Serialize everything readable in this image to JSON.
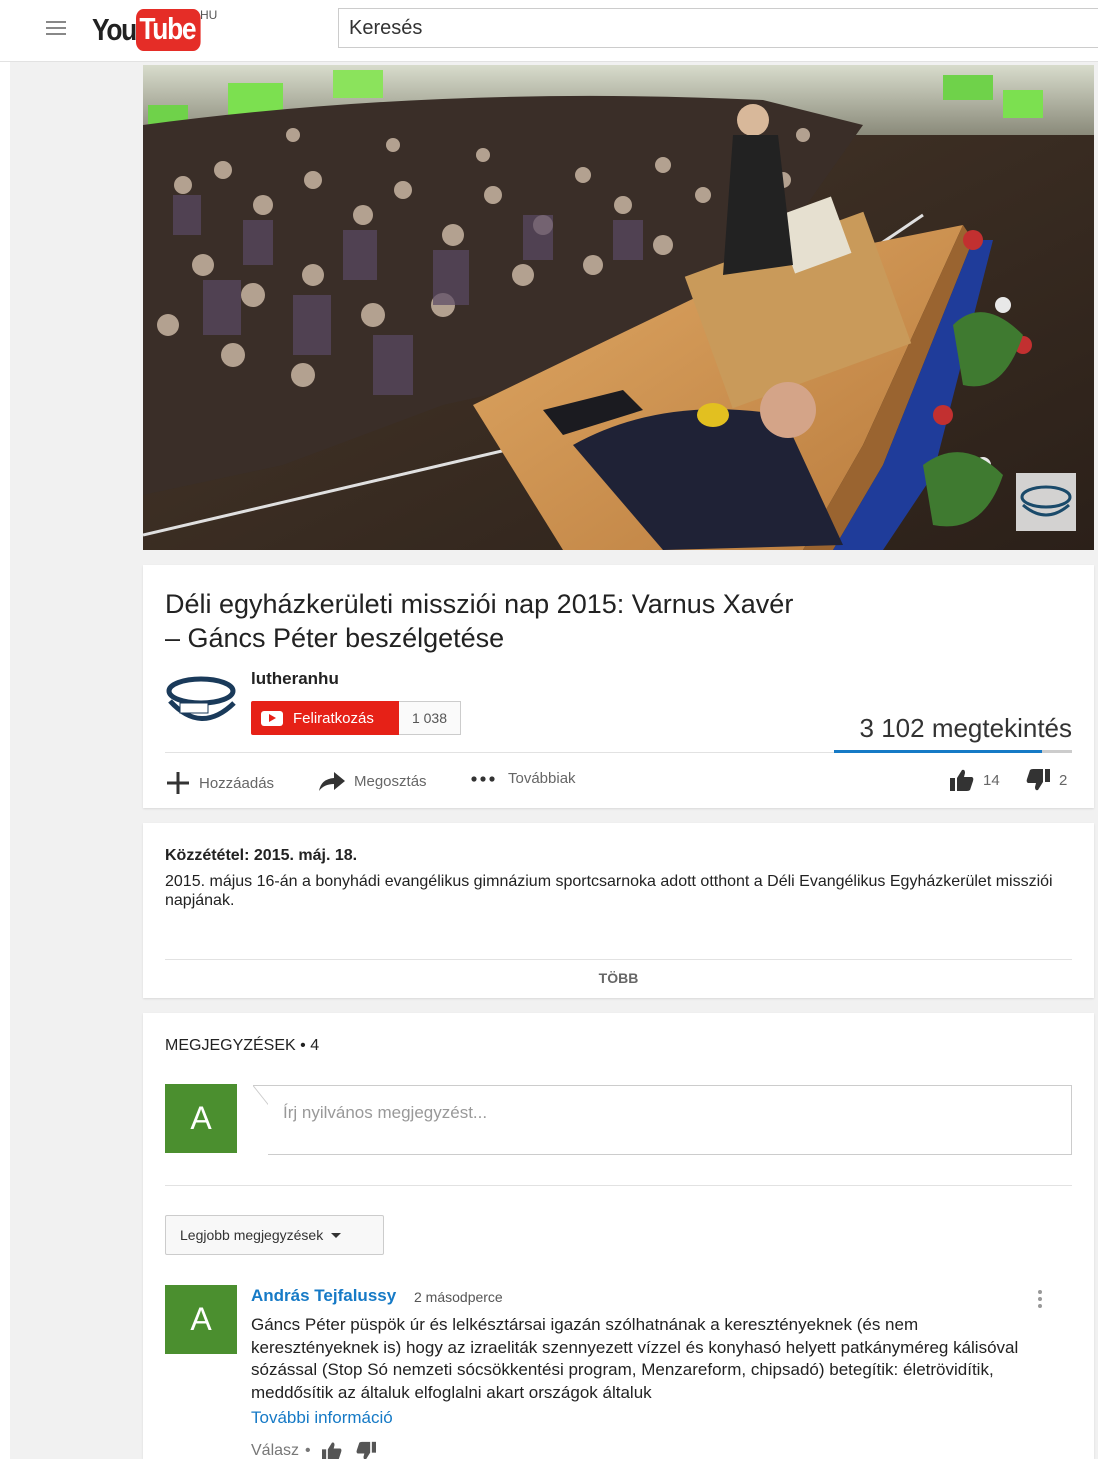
{
  "masthead": {
    "logo_you": "You",
    "logo_tube": "Tube",
    "country_code": "HU",
    "search_placeholder": "Keresés"
  },
  "video": {
    "title": "Déli egyházkerületi missziói nap 2015: Varnus Xavér – Gáncs Péter beszélgetése",
    "channel": {
      "name": "lutheranhu",
      "subscribe_label": "Feliratkozás",
      "subscriber_count": "1 038"
    },
    "views": "3 102 megtekintés",
    "like_ratio": 0.875,
    "actions": {
      "add_label": "Hozzáadás",
      "share_label": "Megosztás",
      "more_label": "Továbbiak"
    },
    "likes": "14",
    "dislikes": "2"
  },
  "description": {
    "published": "Közzététel: 2015. máj. 18.",
    "text": "2015. május 16-án a bonyhádi evangélikus gimnázium sportcsarnoka adott otthont a Déli Evangélikus Egyházkerület missziói napjának.",
    "more_label": "TÖBB"
  },
  "comments": {
    "header": "MEGJEGYZÉSEK • 4",
    "my_avatar_letter": "A",
    "input_placeholder": "Írj nyilvános megjegyzést...",
    "sort_label": "Legjobb megjegyzések",
    "items": [
      {
        "avatar_letter": "A",
        "author": "András Tejfalussy",
        "time": "2 másodperce",
        "text": "Gáncs Péter püspök úr és lelkésztársai igazán szólhatnának a keresztényeknek (és nem keresztényeknek is) hogy az izraeliták szennyezett vízzel és konyhasó helyett patkányméreg kálisóval sózással (Stop Só nemzeti sócsökkentési program, Menzareform, chipsadó) betegítik: életrövidítik, meddősítik az általuk elfoglalni akart országok általuk",
        "read_more": "További információ",
        "reply_label": "Válasz",
        "separator": "•"
      }
    ]
  },
  "colors": {
    "brand_red": "#e62117",
    "link_blue": "#167ac6",
    "avatar_green": "#4b8f2f"
  }
}
